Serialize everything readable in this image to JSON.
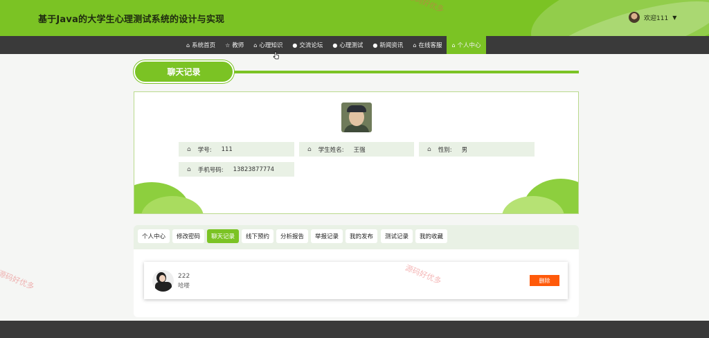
{
  "header": {
    "site_title": "基于Java的大学生心理测试系统的设计与实现",
    "welcome": "欢迎111",
    "caret": "▼"
  },
  "nav": {
    "items": [
      {
        "label": "系统首页",
        "icon": "home-icon",
        "glyph": "⌂"
      },
      {
        "label": "教师",
        "icon": "star-icon",
        "glyph": "☆"
      },
      {
        "label": "心理知识",
        "icon": "bag-icon",
        "glyph": "⌂"
      },
      {
        "label": "交流论坛",
        "icon": "info-icon",
        "glyph": "●"
      },
      {
        "label": "心理测试",
        "icon": "question-icon",
        "glyph": "●"
      },
      {
        "label": "新闻资讯",
        "icon": "info-icon",
        "glyph": "●"
      },
      {
        "label": "在线客服",
        "icon": "home-icon",
        "glyph": "⌂"
      },
      {
        "label": "个人中心",
        "icon": "home-icon",
        "glyph": "⌂"
      }
    ],
    "active_index": 7
  },
  "section": {
    "title": "聊天记录"
  },
  "profile": {
    "fields": [
      {
        "label": "学号:",
        "value": "111",
        "icon": "home-icon"
      },
      {
        "label": "学生姓名:",
        "value": "王强",
        "icon": "home-icon"
      },
      {
        "label": "性别:",
        "value": "男",
        "icon": "home-icon"
      },
      {
        "label": "手机号码:",
        "value": "13823877774",
        "icon": "home-icon"
      }
    ]
  },
  "tabs": {
    "items": [
      "个人中心",
      "修改密码",
      "聊天记录",
      "线下预约",
      "分析报告",
      "举报记录",
      "我的发布",
      "测试记录",
      "我的收藏"
    ],
    "active_index": 2
  },
  "chat": {
    "items": [
      {
        "name": "222",
        "message": "哈喽",
        "delete_label": "删除"
      }
    ]
  },
  "watermark": {
    "text": "源码好优多"
  },
  "colors": {
    "brand_green": "#7bc324",
    "nav_dark": "#3a3a3a",
    "delete_orange": "#ff5a0a"
  }
}
